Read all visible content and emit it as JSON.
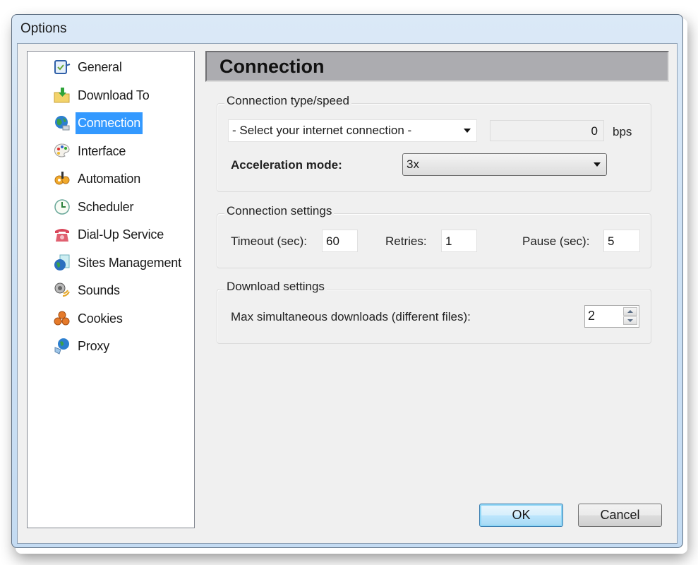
{
  "window": {
    "title": "Options"
  },
  "sidebar": {
    "items": [
      {
        "label": "General",
        "icon": "checklist-icon"
      },
      {
        "label": "Download To",
        "icon": "folder-download-icon"
      },
      {
        "label": "Connection",
        "icon": "globe-network-icon",
        "selected": true
      },
      {
        "label": "Interface",
        "icon": "palette-icon"
      },
      {
        "label": "Automation",
        "icon": "gears-icon"
      },
      {
        "label": "Scheduler",
        "icon": "clock-icon"
      },
      {
        "label": "Dial-Up Service",
        "icon": "telephone-icon"
      },
      {
        "label": "Sites Management",
        "icon": "globe-page-icon"
      },
      {
        "label": "Sounds",
        "icon": "speaker-icon"
      },
      {
        "label": "Cookies",
        "icon": "cookies-icon"
      },
      {
        "label": "Proxy",
        "icon": "globe-proxy-icon"
      }
    ]
  },
  "header": {
    "title": "Connection"
  },
  "connection_type": {
    "legend": "Connection type/speed",
    "connection_select": "- Select your internet connection -",
    "speed_value": "0",
    "speed_unit": "bps",
    "acceleration_label": "Acceleration mode:",
    "acceleration_value": "3x"
  },
  "connection_settings": {
    "legend": "Connection settings",
    "timeout_label": "Timeout (sec):",
    "timeout_value": "60",
    "retries_label": "Retries:",
    "retries_value": "1",
    "pause_label": "Pause (sec):",
    "pause_value": "5"
  },
  "download_settings": {
    "legend": "Download settings",
    "max_label": "Max simultaneous downloads (different files):",
    "max_value": "2"
  },
  "buttons": {
    "ok": "OK",
    "cancel": "Cancel"
  },
  "colors": {
    "selection": "#3399ff",
    "header_bg": "#acacb0",
    "window_frame": "#cfe2f5"
  }
}
